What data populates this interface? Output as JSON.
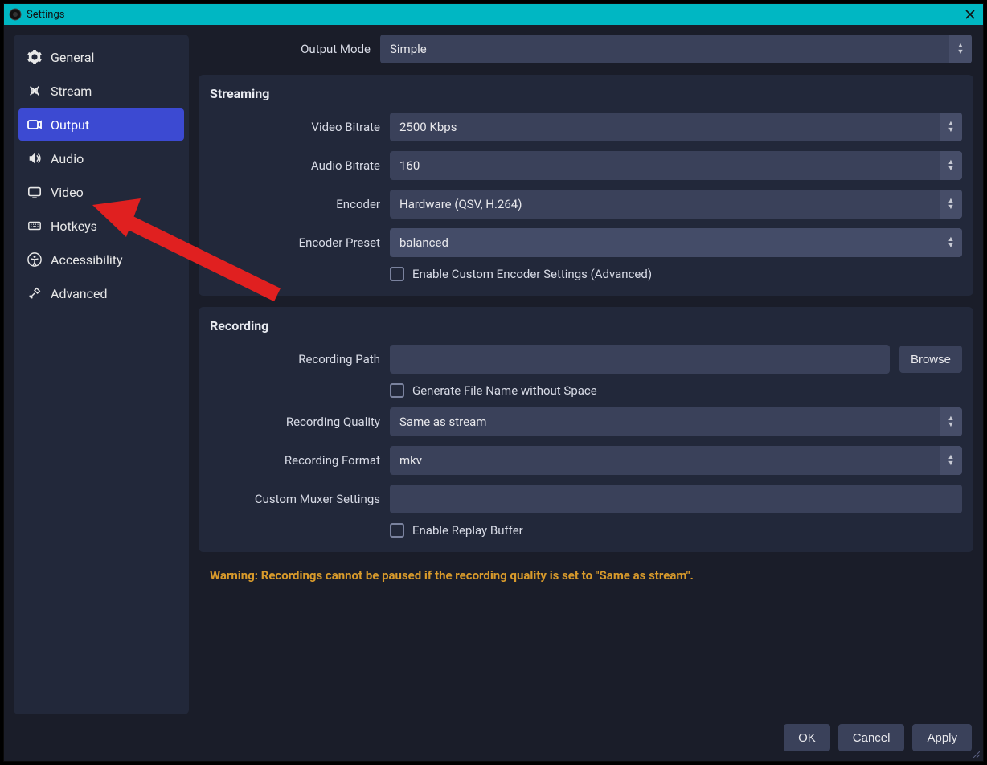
{
  "window": {
    "title": "Settings"
  },
  "sidebar": {
    "items": [
      {
        "id": "general",
        "label": "General"
      },
      {
        "id": "stream",
        "label": "Stream"
      },
      {
        "id": "output",
        "label": "Output",
        "active": true
      },
      {
        "id": "audio",
        "label": "Audio"
      },
      {
        "id": "video",
        "label": "Video"
      },
      {
        "id": "hotkeys",
        "label": "Hotkeys"
      },
      {
        "id": "accessibility",
        "label": "Accessibility"
      },
      {
        "id": "advanced",
        "label": "Advanced"
      }
    ]
  },
  "output_mode": {
    "label": "Output Mode",
    "value": "Simple"
  },
  "streaming": {
    "title": "Streaming",
    "video_bitrate": {
      "label": "Video Bitrate",
      "value": "2500 Kbps"
    },
    "audio_bitrate": {
      "label": "Audio Bitrate",
      "value": "160"
    },
    "encoder": {
      "label": "Encoder",
      "value": "Hardware (QSV, H.264)"
    },
    "encoder_preset": {
      "label": "Encoder Preset",
      "value": "balanced"
    },
    "enable_custom": {
      "label": "Enable Custom Encoder Settings (Advanced)",
      "checked": false
    }
  },
  "recording": {
    "title": "Recording",
    "path": {
      "label": "Recording Path",
      "value": "",
      "browse": "Browse"
    },
    "no_space": {
      "label": "Generate File Name without Space",
      "checked": false
    },
    "quality": {
      "label": "Recording Quality",
      "value": "Same as stream"
    },
    "format": {
      "label": "Recording Format",
      "value": "mkv"
    },
    "muxer": {
      "label": "Custom Muxer Settings",
      "value": ""
    },
    "replay_buffer": {
      "label": "Enable Replay Buffer",
      "checked": false
    }
  },
  "warning": "Warning: Recordings cannot be paused if the recording quality is set to \"Same as stream\".",
  "footer": {
    "ok": "OK",
    "cancel": "Cancel",
    "apply": "Apply"
  }
}
